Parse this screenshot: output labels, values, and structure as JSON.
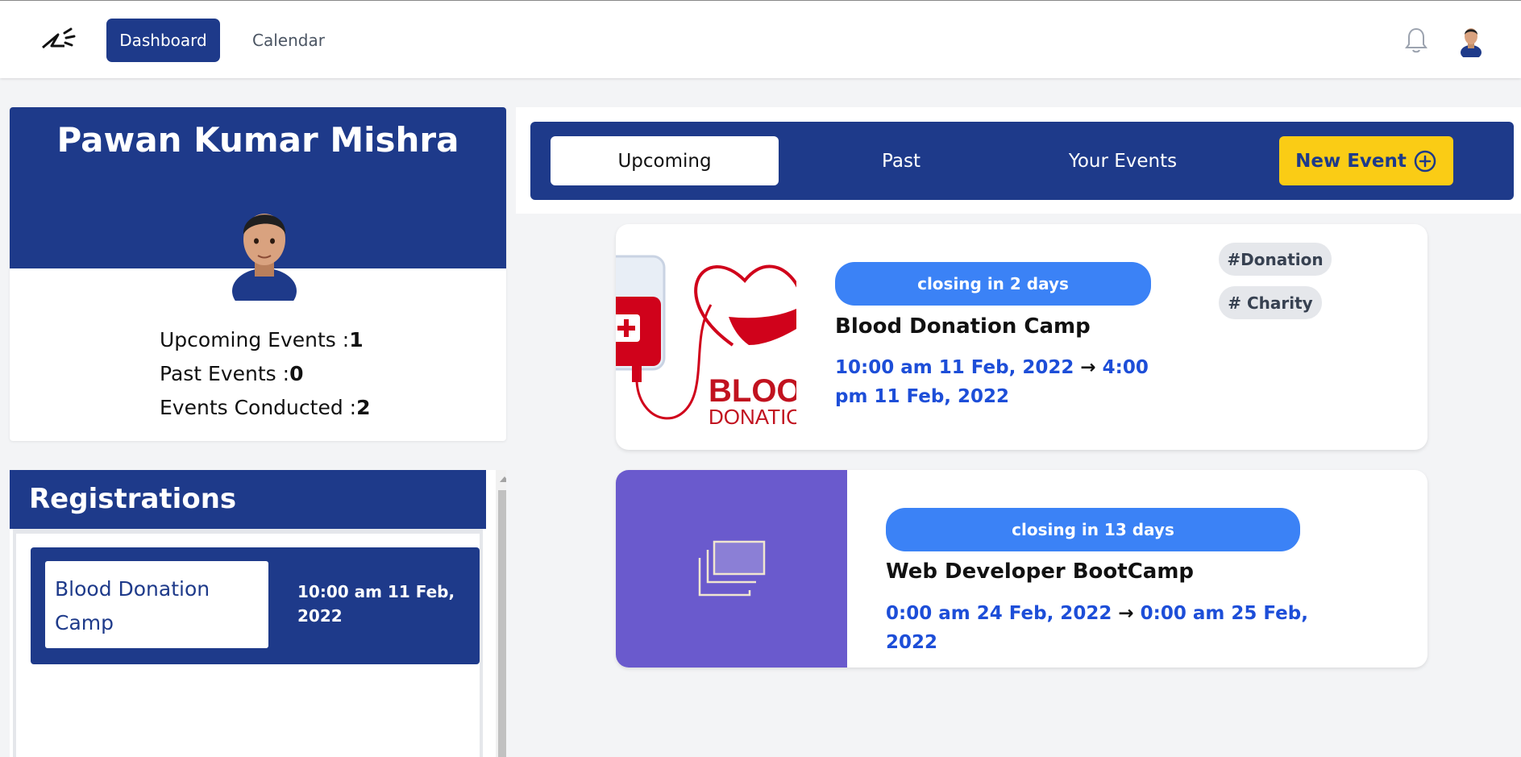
{
  "nav": {
    "dashboard_label": "Dashboard",
    "calendar_label": "Calendar"
  },
  "profile": {
    "name": "Pawan Kumar Mishra",
    "stats": [
      {
        "label": "Upcoming Events :",
        "value": "1"
      },
      {
        "label": "Past Events :",
        "value": "0"
      },
      {
        "label": "Events Conducted :",
        "value": "2"
      }
    ]
  },
  "registrations": {
    "title": "Registrations",
    "items": [
      {
        "title": "Blood Donation Camp",
        "date": "10:00 am 11 Feb, 2022"
      }
    ]
  },
  "tabs": {
    "upcoming": "Upcoming",
    "past": "Past",
    "your_events": "Your Events",
    "new_event": "New Event"
  },
  "events": [
    {
      "badge": "closing in 2 days",
      "title": "Blood Donation Camp",
      "start": "10:00 am 11 Feb, 2022",
      "arrow": "→",
      "end": "4:00 pm 11 Feb, 2022",
      "tags": [
        "#Donation",
        "# Charity"
      ],
      "image_text": [
        "BLOOD",
        "DONATION"
      ]
    },
    {
      "badge": "closing in 13 days",
      "title": "Web Developer BootCamp",
      "start": "0:00 am 24 Feb, 2022",
      "arrow": "→",
      "end": "0:00 am 25 Feb, 2022"
    }
  ],
  "colors": {
    "primary": "#1e3a8a",
    "accent_yellow": "#facc15",
    "badge_blue": "#3b82f6",
    "date_blue": "#1d4ed8",
    "placeholder_purple": "#6a5acd"
  },
  "icons": {
    "logo": "megaphone-logo-icon",
    "bell": "bell-icon",
    "avatar": "avatar",
    "new_event": "plus-circle-icon",
    "placeholder": "images-stack-icon"
  }
}
